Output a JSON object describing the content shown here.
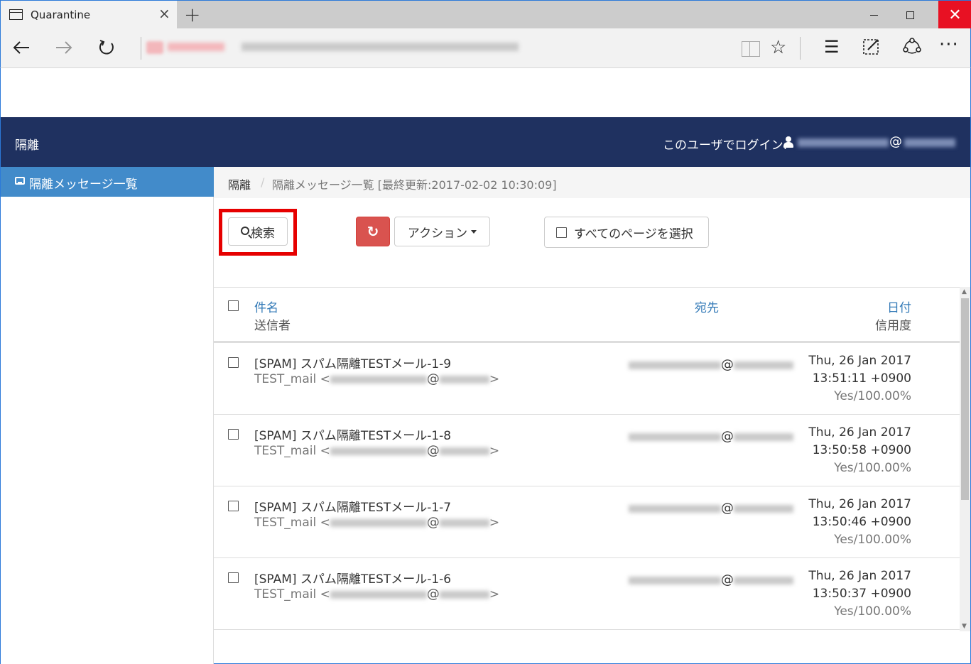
{
  "browser": {
    "tab_title": "Quarantine",
    "tab_close": "×",
    "new_tab": "+",
    "window_close": "✕",
    "icons": [
      "page-icon",
      "back-icon",
      "forward-icon",
      "refresh-icon",
      "reading-view-icon",
      "favorite-star-icon",
      "hub-icon",
      "web-note-icon",
      "share-icon",
      "more-icon"
    ]
  },
  "header": {
    "title": "隔離",
    "login_label": "このユーザでログイン:",
    "at": "@"
  },
  "sidebar": {
    "items": [
      {
        "label": "隔離メッセージ一覧",
        "icon": "inbox-icon",
        "active": true
      }
    ]
  },
  "breadcrumb": {
    "home": "隔離",
    "separator": "/",
    "current": "隔離メッセージ一覧 [最終更新:2017-02-02 10:30:09]"
  },
  "toolbar": {
    "search_label": "検索",
    "refresh_icon": "↻",
    "action_label": "アクション",
    "select_all_label": "すべてのページを選択"
  },
  "table": {
    "headers": {
      "subject": "件名",
      "sender": "送信者",
      "to": "宛先",
      "date": "日付",
      "score": "信用度"
    },
    "rows": [
      {
        "subject": "[SPAM] スパム隔離TESTメール-1-9",
        "sender_name": "TEST_mail <",
        "sender_at": "@",
        "sender_end": ">",
        "to_at": "@",
        "date1": "Thu, 26 Jan 2017",
        "date2": "13:51:11 +0900",
        "score": "Yes/100.00%"
      },
      {
        "subject": "[SPAM] スパム隔離TESTメール-1-8",
        "sender_name": "TEST_mail <",
        "sender_at": "@",
        "sender_end": ">",
        "to_at": "@",
        "date1": "Thu, 26 Jan 2017",
        "date2": "13:50:58 +0900",
        "score": "Yes/100.00%"
      },
      {
        "subject": "[SPAM] スパム隔離TESTメール-1-7",
        "sender_name": "TEST_mail <",
        "sender_at": "@",
        "sender_end": ">",
        "to_at": "@",
        "date1": "Thu, 26 Jan 2017",
        "date2": "13:50:46 +0900",
        "score": "Yes/100.00%"
      },
      {
        "subject": "[SPAM] スパム隔離TESTメール-1-6",
        "sender_name": "TEST_mail <",
        "sender_at": "@",
        "sender_end": ">",
        "to_at": "@",
        "date1": "Thu, 26 Jan 2017",
        "date2": "13:50:37 +0900",
        "score": "Yes/100.00%"
      }
    ]
  },
  "colors": {
    "header_bg": "#1f3160",
    "sidebar_active": "#428bca",
    "link": "#337ab7",
    "danger": "#d9534f",
    "highlight_box": "#e60000"
  }
}
